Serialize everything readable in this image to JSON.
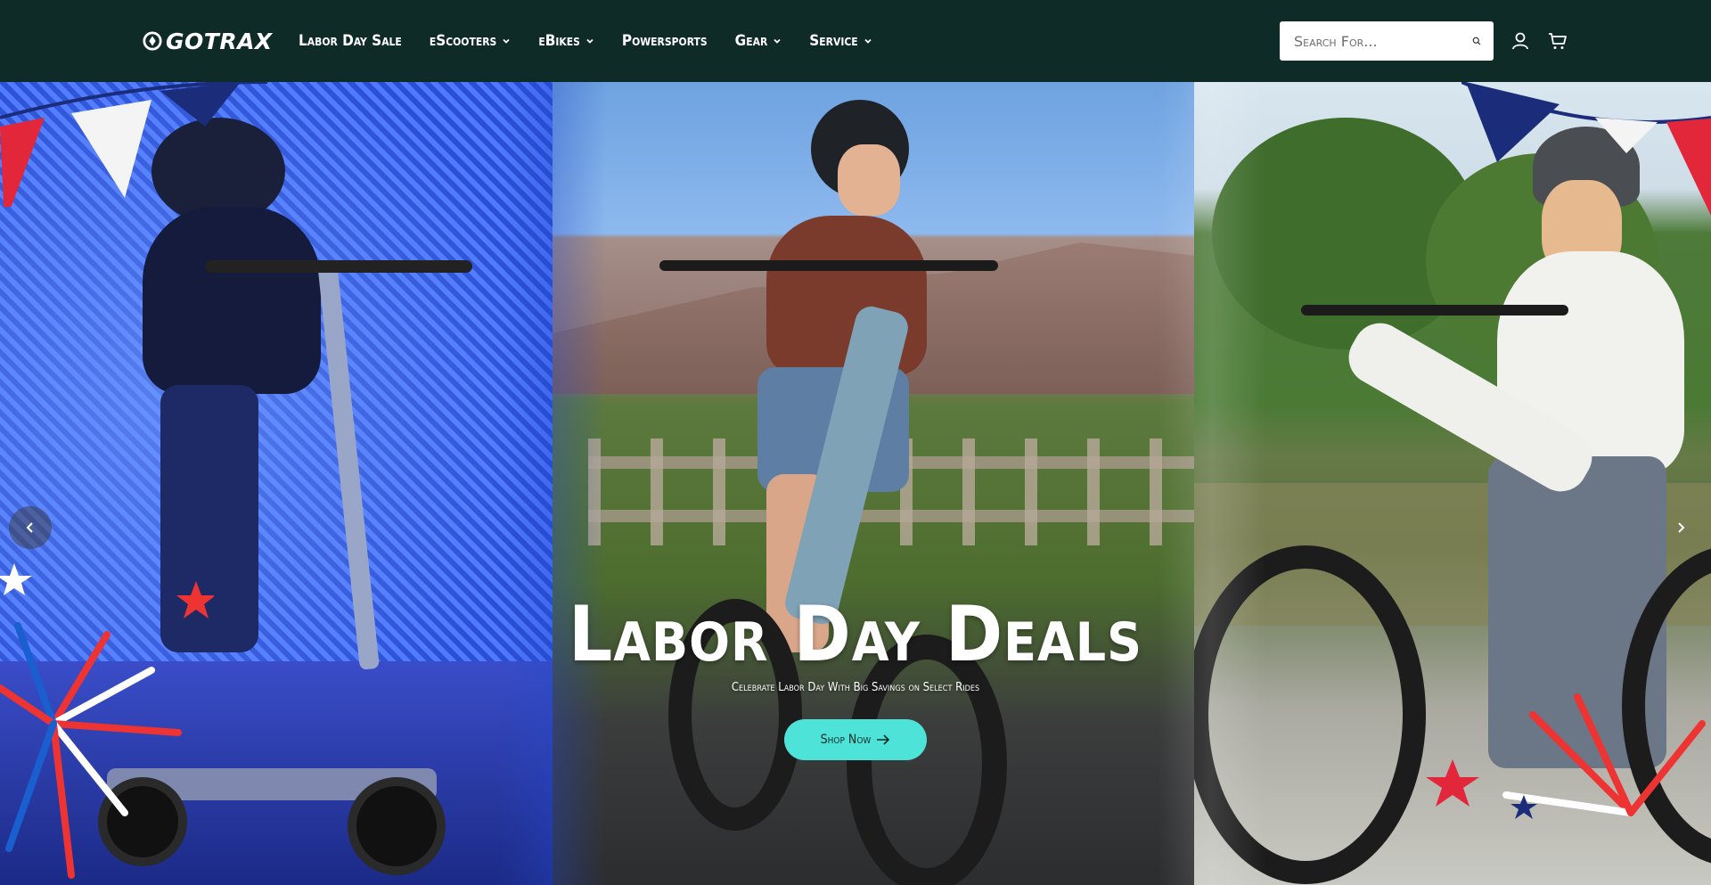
{
  "header": {
    "logo_text": "GOTRAX",
    "nav": [
      {
        "label": "Labor Day Sale",
        "has_dropdown": false
      },
      {
        "label": "eScooters",
        "has_dropdown": true
      },
      {
        "label": "eBikes",
        "has_dropdown": true
      },
      {
        "label": "Powersports",
        "has_dropdown": false
      },
      {
        "label": "Gear",
        "has_dropdown": true
      },
      {
        "label": "Service",
        "has_dropdown": true
      }
    ],
    "search": {
      "placeholder": "Search For..."
    },
    "icons": [
      "search-icon",
      "account-icon",
      "cart-icon"
    ]
  },
  "hero": {
    "title": "Labor Day Deals",
    "subtitle": "Celebrate Labor Day With Big Savings on Select Rides",
    "cta_label": "Shop Now",
    "cta_icon": "arrow-right-icon",
    "prev_icon": "chevron-left-icon",
    "next_icon": "chevron-right-icon",
    "colors": {
      "header_bg": "#0f2b27",
      "cta_bg": "#4ee3d8"
    }
  }
}
